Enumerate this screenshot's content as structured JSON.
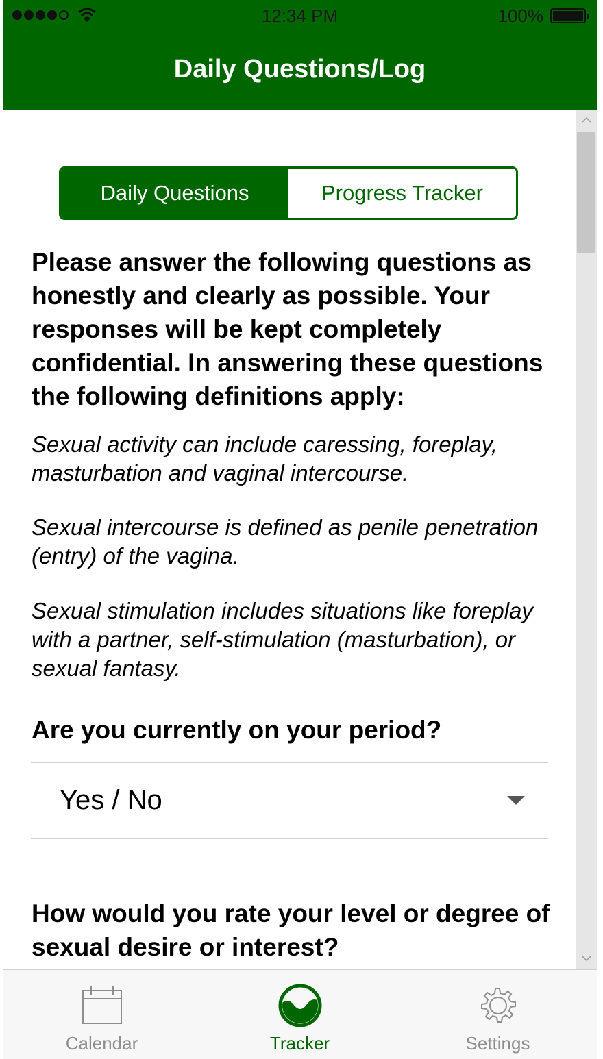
{
  "status_bar": {
    "time": "12:34 PM",
    "battery_percent": "100%",
    "signal_icon": "signal-dots-icon",
    "wifi_icon": "wifi-icon",
    "battery_icon": "battery-icon"
  },
  "header": {
    "title": "Daily Questions/Log",
    "background_color": "#006600"
  },
  "segmented_control": {
    "tabs": [
      {
        "label": "Daily Questions",
        "selected": true
      },
      {
        "label": "Progress Tracker",
        "selected": false
      }
    ],
    "accent_color": "#006600"
  },
  "form": {
    "intro": "Please answer the following questions as honestly and clearly as possible. Your responses will be kept completely confidential. In answering these questions the following definitions apply:",
    "definitions": [
      "Sexual activity can include caressing, foreplay, masturbation and vaginal intercourse.",
      "Sexual intercourse is defined as penile penetration (entry) of the vagina.",
      "Sexual stimulation includes situations like foreplay with a partner, self-stimulation (masturbation), or sexual fantasy."
    ],
    "questions": [
      {
        "text": "Are you currently on your period?",
        "select_value": "Yes / No"
      },
      {
        "text": "How would you rate your level or degree of sexual desire or interest?"
      }
    ]
  },
  "tab_bar": {
    "items": [
      {
        "label": "Calendar",
        "icon": "calendar-icon",
        "active": false
      },
      {
        "label": "Tracker",
        "icon": "tracker-icon",
        "active": true
      },
      {
        "label": "Settings",
        "icon": "gear-icon",
        "active": false
      }
    ]
  }
}
